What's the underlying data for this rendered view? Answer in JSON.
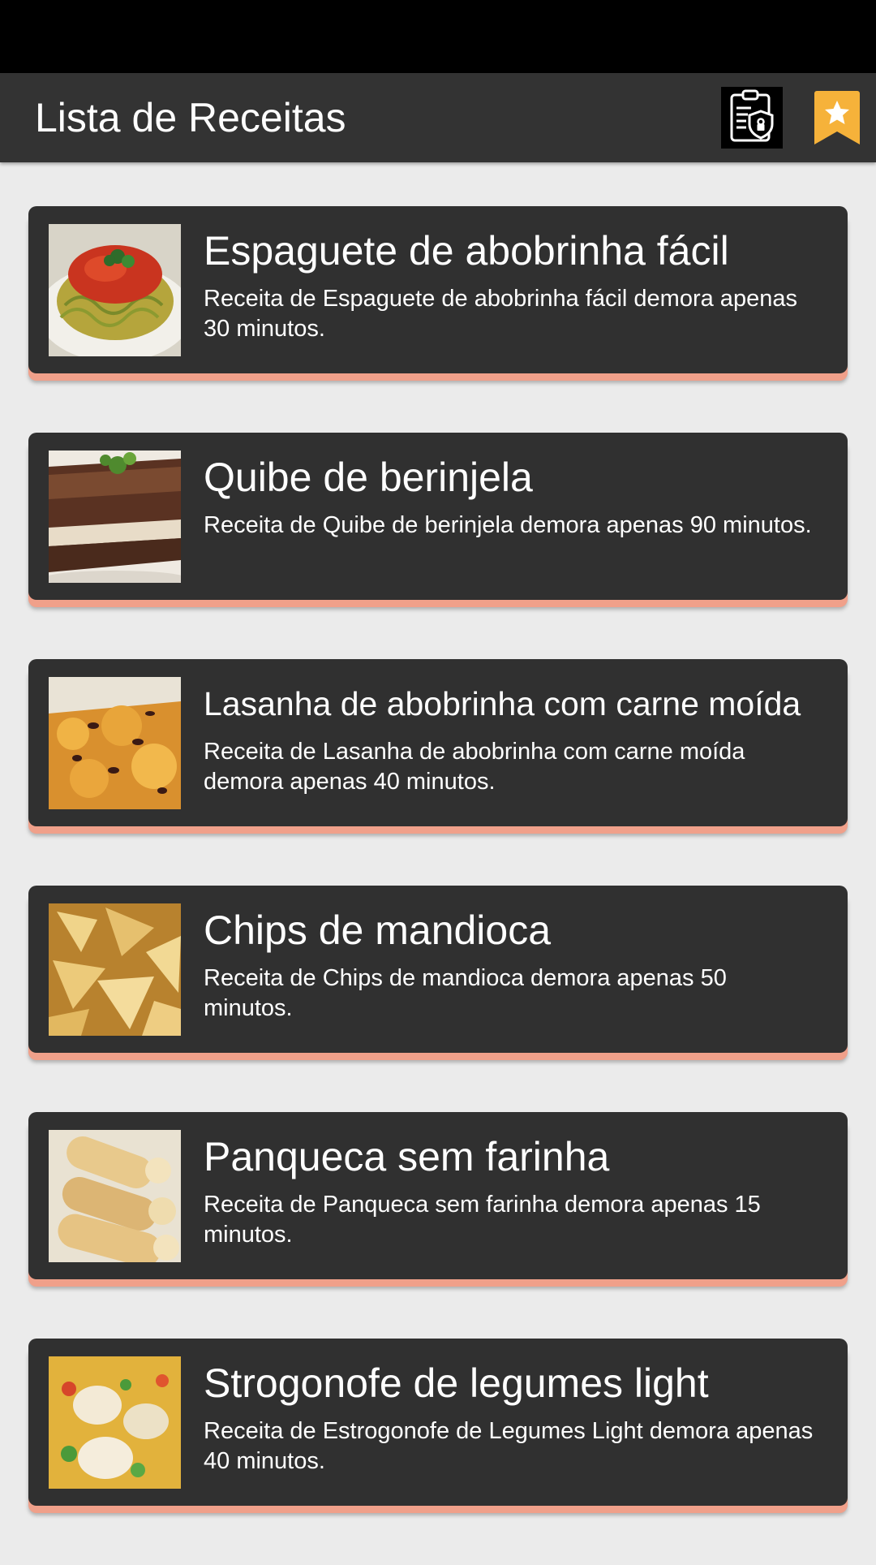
{
  "app_bar": {
    "title": "Lista de Receitas",
    "privacy_icon": "privacy-policy-shield-icon",
    "favorites_icon": "bookmark-star-icon",
    "accent_color": "#f6b23a"
  },
  "recipes": [
    {
      "title": "Espaguete de abobrinha fácil",
      "description": "Receita de Espaguete de abobrinha fácil demora apenas 30 minutos."
    },
    {
      "title": "Quibe de berinjela",
      "description": "Receita de Quibe de berinjela demora apenas 90 minutos."
    },
    {
      "title": "Lasanha de abobrinha com carne moída",
      "description": "Receita de Lasanha de abobrinha com carne moída demora apenas 40 minutos."
    },
    {
      "title": "Chips de mandioca",
      "description": "Receita de Chips de mandioca demora apenas 50 minutos."
    },
    {
      "title": "Panqueca sem farinha",
      "description": "Receita de Panqueca sem farinha demora apenas 15 minutos."
    },
    {
      "title": "Strogonofe de legumes light",
      "description": "Receita de Estrogonofe de Legumes Light demora apenas 40 minutos."
    }
  ],
  "colors": {
    "card_background": "#303030",
    "card_accent": "#f0a08a",
    "page_background": "#ebebeb"
  }
}
